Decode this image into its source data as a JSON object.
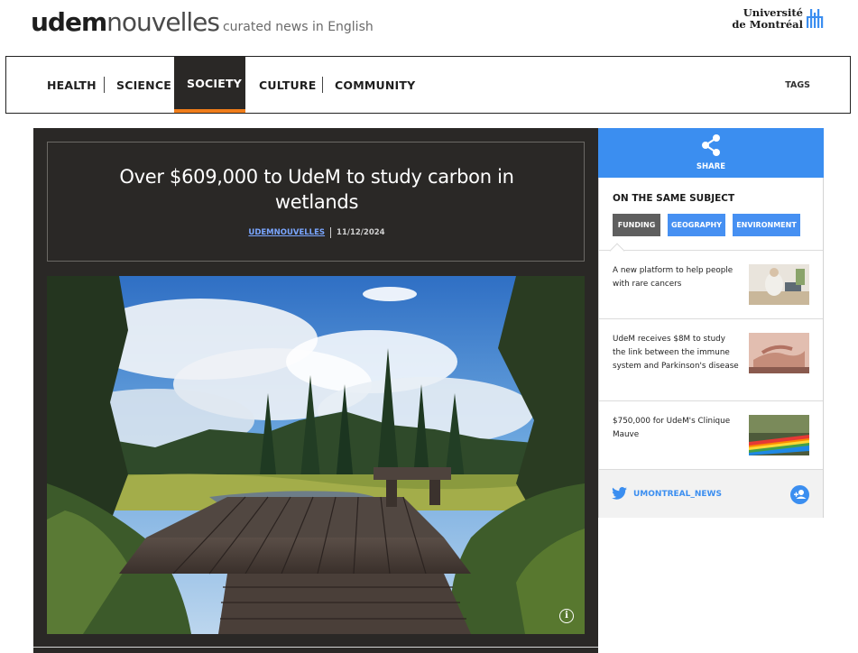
{
  "header": {
    "brand_bold": "udem",
    "brand_light": "nouvelles",
    "tagline": "curated news in English",
    "logo_line1": "Université",
    "logo_line2": "de Montréal"
  },
  "nav": {
    "items": [
      {
        "label": "HEALTH"
      },
      {
        "label": "SCIENCE"
      },
      {
        "label": "SOCIETY",
        "active": true
      },
      {
        "label": "CULTURE"
      },
      {
        "label": "COMMUNITY"
      }
    ],
    "tags_label": "TAGS",
    "active_color": "#f07d1a"
  },
  "article": {
    "title": "Over $609,000 to UdeM to study carbon in wetlands",
    "author": "UDEMNOUVELLES",
    "date": "11/12/2024",
    "photo_icon": "info-icon"
  },
  "sidebar": {
    "share_label": "SHARE",
    "share_icon": "share-icon",
    "same_subject": "ON THE SAME SUBJECT",
    "tags": [
      {
        "label": "FUNDING"
      },
      {
        "label": "GEOGRAPHY"
      },
      {
        "label": "ENVIRONMENT"
      }
    ],
    "related": [
      {
        "title": "A new platform to help people with rare cancers"
      },
      {
        "title": "UdeM receives $8M to study the link between the immune system and Parkinson's disease"
      },
      {
        "title": "$750,000 for UdeM's Clinique Mauve"
      }
    ],
    "twitter_handle": "UMONTREAL_NEWS",
    "twitter_icon": "twitter-icon",
    "follow_icon": "follow-icon"
  },
  "colors": {
    "accent_blue": "#3b8ef0",
    "dark_bg": "#2a2826",
    "nav_active_underline": "#f07d1a"
  }
}
